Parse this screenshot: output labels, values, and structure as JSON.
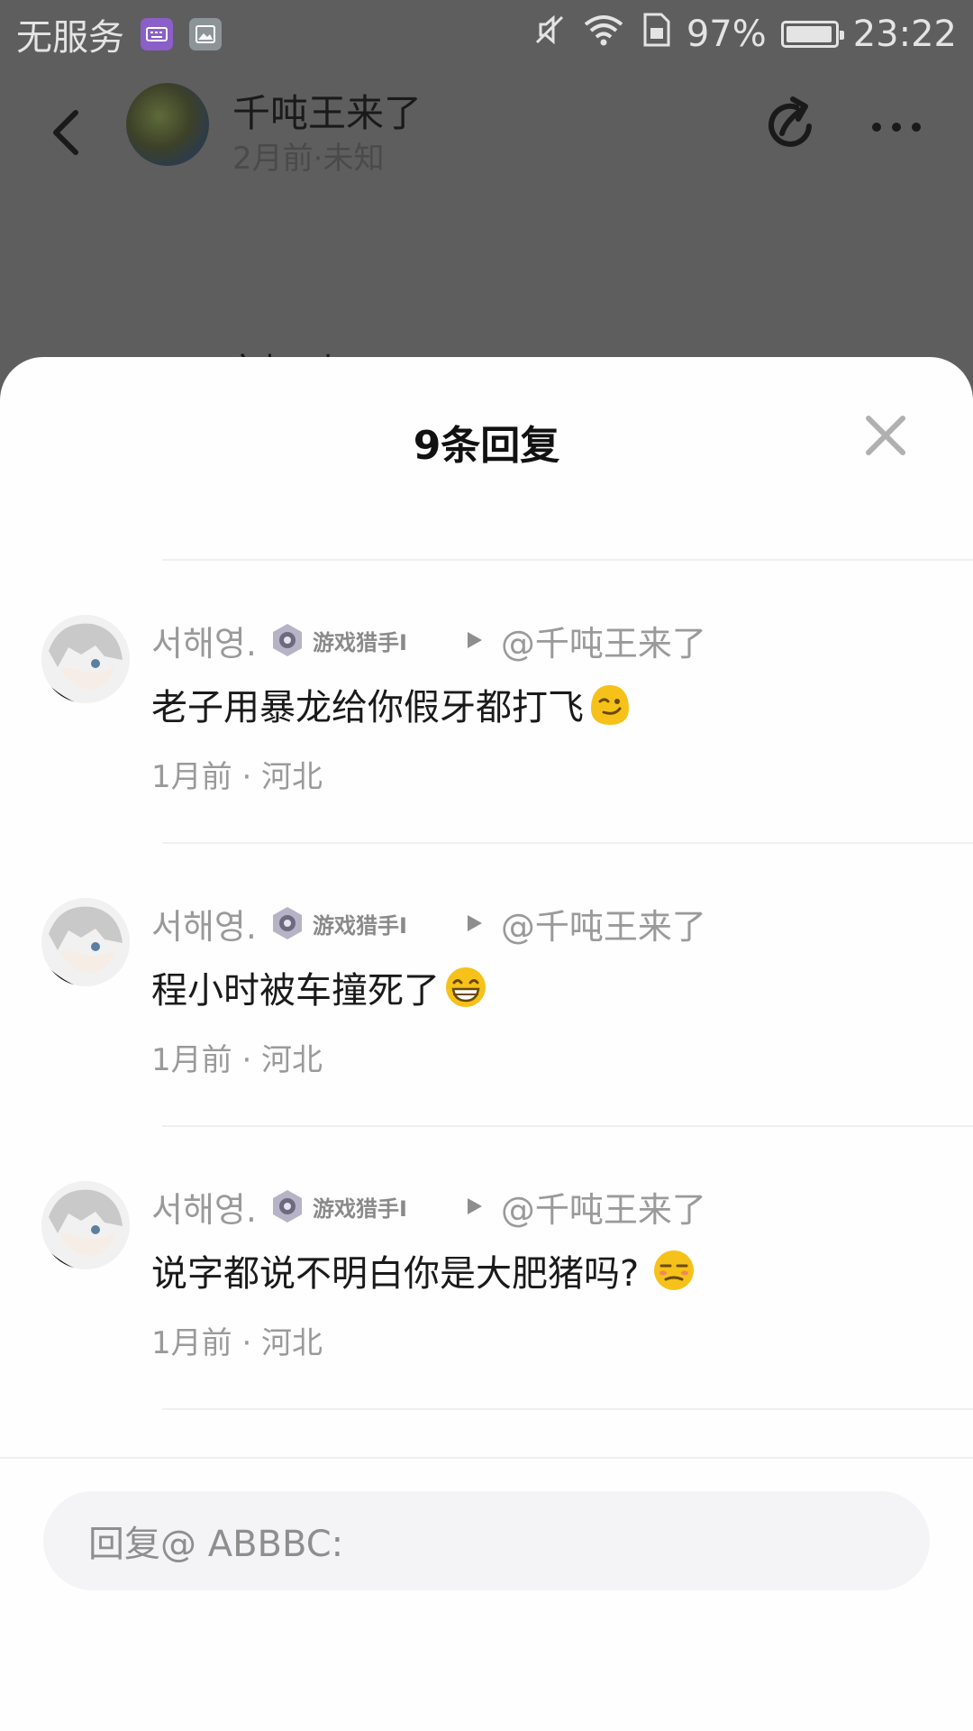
{
  "status_bar": {
    "carrier": "无服务",
    "battery": "97%",
    "battery_level": 0.97,
    "time": "23:22"
  },
  "post_header": {
    "author": "千吨王来了",
    "meta": "2月前·未知",
    "peek_text": "文打叫"
  },
  "sheet": {
    "title": "9条回复"
  },
  "comments": [
    {
      "user": "서해영.",
      "badge": "游戏猎手I",
      "target": "@千吨王来了",
      "text": "老子用暴龙给你假牙都打飞",
      "emoji": "wink-emoji",
      "meta": "1月前 · 河北"
    },
    {
      "user": "서해영.",
      "badge": "游戏猎手I",
      "target": "@千吨王来了",
      "text": "程小时被车撞死了",
      "emoji": "grin-emoji",
      "meta": "1月前 · 河北"
    },
    {
      "user": "서해영.",
      "badge": "游戏猎手I",
      "target": "@千吨王来了",
      "text": "说字都说不明白你是大肥猪吗?",
      "emoji": "unamused-emoji",
      "meta": "1月前 · 河北"
    }
  ],
  "reply_input": {
    "placeholder": "回复@ ABBBC:"
  }
}
